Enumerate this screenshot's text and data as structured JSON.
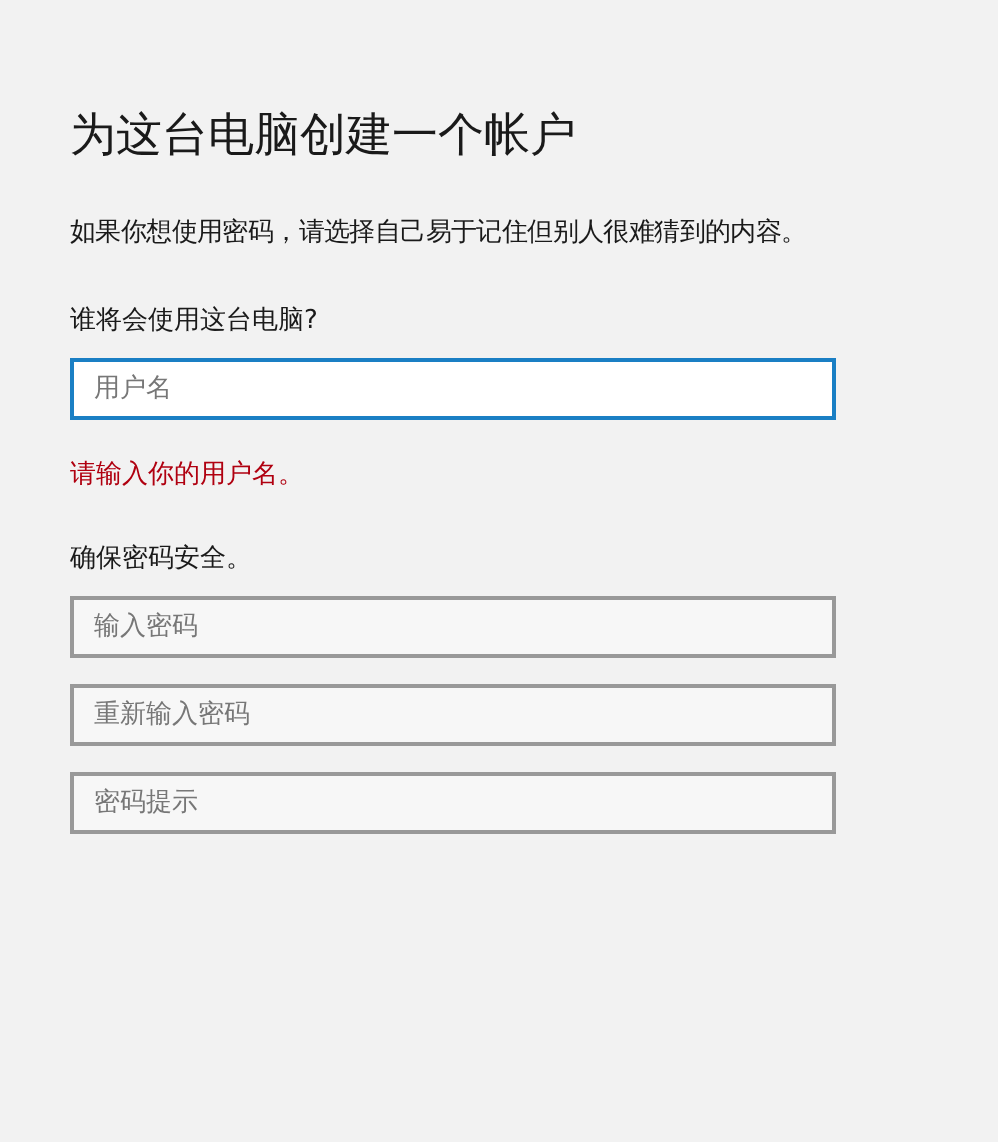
{
  "title": "为这台电脑创建一个帐户",
  "description": "如果你想使用密码，请选择自己易于记住但别人很难猜到的内容。",
  "user_section": {
    "label": "谁将会使用这台电脑?",
    "field": {
      "placeholder": "用户名",
      "focused": true
    },
    "error": "请输入你的用户名。"
  },
  "password_section": {
    "label": "确保密码安全。",
    "fields": [
      {
        "placeholder": "输入密码",
        "focused": false
      },
      {
        "placeholder": "重新输入密码",
        "focused": false
      },
      {
        "placeholder": "密码提示",
        "focused": false
      }
    ]
  }
}
